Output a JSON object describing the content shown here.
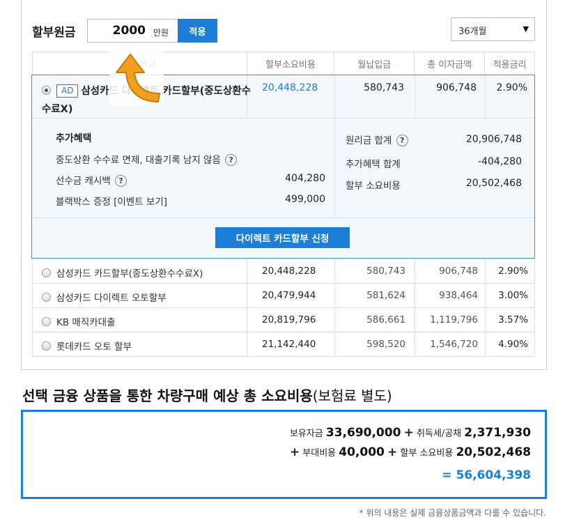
{
  "principal": {
    "label": "할부원금",
    "amount": "2000",
    "unit": "만원",
    "apply_label": "적용"
  },
  "term": {
    "selected": "36개월"
  },
  "table": {
    "headers": [
      "상품비교",
      "할부소요비용",
      "월납입금",
      "총 이자금액",
      "적용금리"
    ]
  },
  "selected": {
    "ad": "AD",
    "name": "삼성카드 다이렉트 카드할부(중도상환수수료X)",
    "cost": "20,448,228",
    "monthly": "580,743",
    "interest": "906,748",
    "rate": "2.90%",
    "benefit_title": "추가혜택",
    "benefits": [
      {
        "label": "중도상환 수수료 면제, 대출기록 남지 않음",
        "value": ""
      },
      {
        "label": "선수금 캐시백",
        "value": "404,280"
      },
      {
        "label": "블랙박스 증정 [이벤트 보기]",
        "value": "499,000"
      }
    ],
    "summary": [
      {
        "label": "원리금 합계",
        "value": "20,906,748"
      },
      {
        "label": "추가혜택 합계",
        "value": "-404,280"
      },
      {
        "label": "할부 소요비용",
        "value": "20,502,468"
      }
    ],
    "apply_button": "다이렉트 카드할부 신청"
  },
  "rows": [
    {
      "name": "삼성카드 카드할부(중도상환수수료X)",
      "cost": "20,448,228",
      "monthly": "580,743",
      "interest": "906,748",
      "rate": "2.90%"
    },
    {
      "name": "삼성카드 다이렉트 오토할부",
      "cost": "20,479,944",
      "monthly": "581,624",
      "interest": "938,464",
      "rate": "3.00%"
    },
    {
      "name": "KB 매직카대출",
      "cost": "20,819,796",
      "monthly": "586,661",
      "interest": "1,119,796",
      "rate": "3.57%"
    },
    {
      "name": "롯데카드 오토 할부",
      "cost": "21,142,440",
      "monthly": "598,520",
      "interest": "1,546,720",
      "rate": "4.90%"
    }
  ],
  "total": {
    "title": "선택 금융 상품을 통한 차량구매 예상 총 소요비용",
    "title_note": "(보험료 별도)",
    "own_label": "보유자금",
    "own_value": "33,690,000",
    "tax_label": "취득세/공채",
    "tax_value": "2,371,930",
    "extra_label": "부대비용",
    "extra_value": "40,000",
    "inst_label": "할부 소요비용",
    "inst_value": "20,502,468",
    "plus": "+",
    "result": "= 56,604,398"
  },
  "footnote": "* 위의 내용은 실제 금융상품금액과 다를 수 있습니다.",
  "colors": {
    "accent": "#1c7ed6",
    "arrow": "#f0a020"
  }
}
